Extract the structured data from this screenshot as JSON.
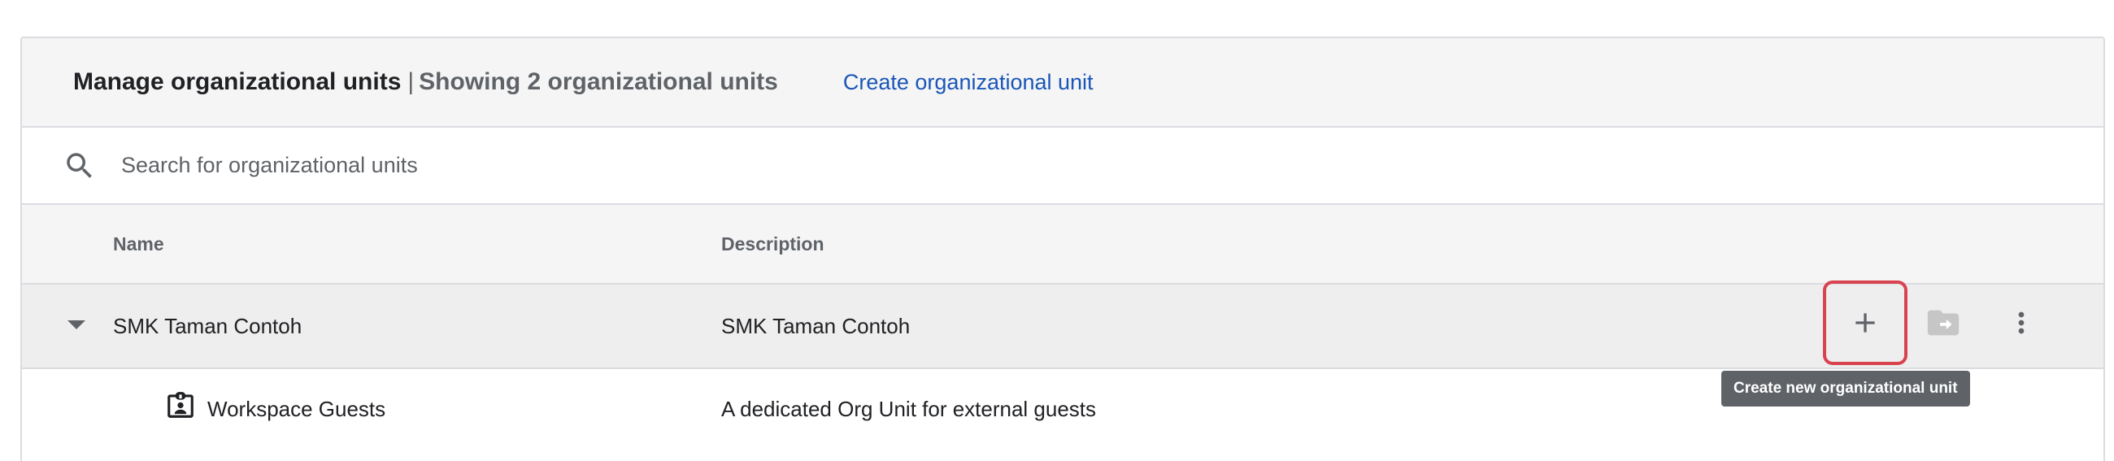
{
  "header": {
    "title": "Manage organizational units",
    "separator": "|",
    "count_text": "Showing 2 organizational units",
    "create_link": "Create organizational unit"
  },
  "search": {
    "placeholder": "Search for organizational units",
    "icon": "search-icon"
  },
  "columns": {
    "name": "Name",
    "description": "Description"
  },
  "rows": [
    {
      "name": "SMK Taman Contoh",
      "description": "SMK Taman Contoh",
      "expanded": true,
      "actions": [
        "plus-icon",
        "move-folder-icon",
        "more-vert-icon"
      ]
    },
    {
      "name": "Workspace Guests",
      "description": "A dedicated Org Unit for external guests",
      "icon": "badge-icon"
    }
  ],
  "tooltip": "Create new organizational unit",
  "colors": {
    "link": "#1a56b8",
    "highlight": "#d9434f",
    "tooltip_bg": "#5f6368",
    "header_bg": "#f5f5f5"
  }
}
